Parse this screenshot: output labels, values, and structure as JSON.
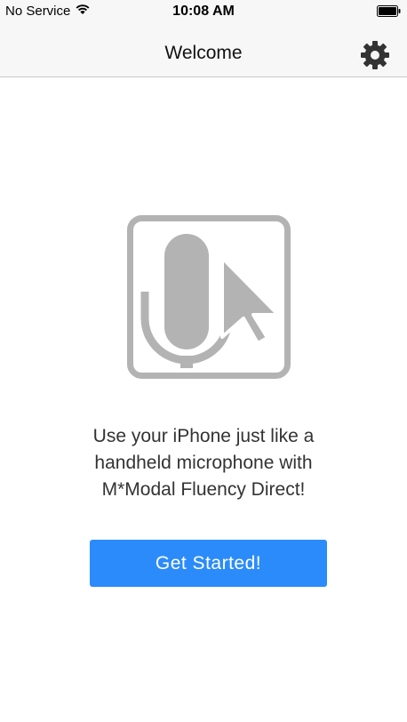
{
  "status_bar": {
    "carrier": "No Service",
    "time": "10:08 AM",
    "wifi_icon": "wifi-icon",
    "battery_icon": "battery-icon"
  },
  "nav": {
    "title": "Welcome",
    "settings_icon": "gear-icon"
  },
  "hero": {
    "icon": "microphone-cursor-icon",
    "color": "#b3b3b3"
  },
  "message": {
    "lines": [
      "Use your iPhone just like a",
      "handheld microphone with",
      "M*Modal Fluency Direct!"
    ]
  },
  "cta": {
    "label": "Get Started!",
    "color": "#2b8bfa"
  }
}
